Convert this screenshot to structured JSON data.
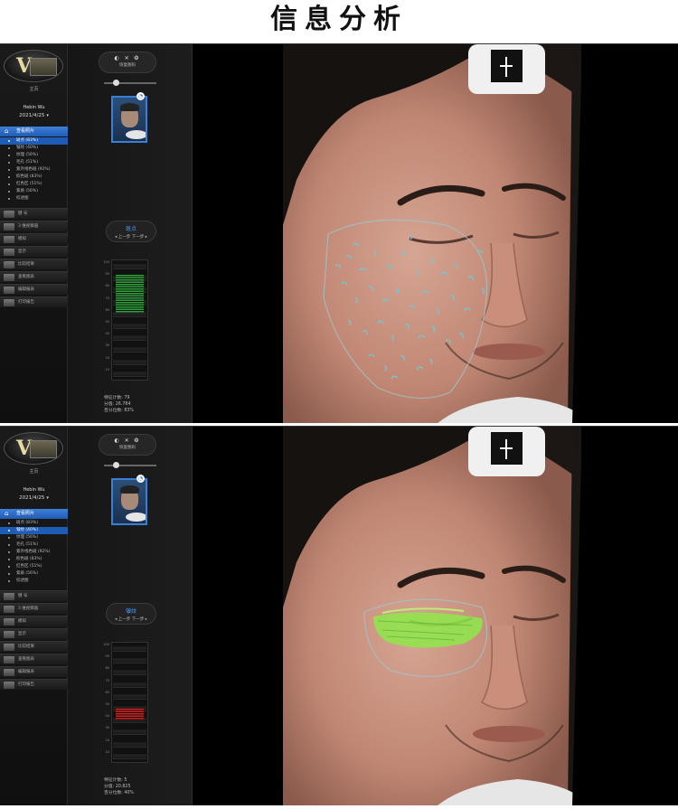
{
  "page": {
    "title": "信息分析"
  },
  "colors": {
    "accent_blue": "#2f6fd0",
    "pore_overlay": "#6fc9d8",
    "wrinkle_overlay": "#8fe84a",
    "gauge_green": "#2fa33a",
    "gauge_red": "#d42020"
  },
  "screens": [
    {
      "sidebar": {
        "home_label": "主页",
        "user_name": "Hebin Wu",
        "date": "2021/4/25",
        "menu_header": "查看照片",
        "analysis_items": [
          {
            "label": "斑点 (83%)",
            "active": true
          },
          {
            "label": "皱纹 (40%)",
            "active": false
          },
          {
            "label": "纹理 (56%)",
            "active": false
          },
          {
            "label": "毛孔 (51%)",
            "active": false
          },
          {
            "label": "紫外线色斑 (92%)",
            "active": false
          },
          {
            "label": "棕色斑 (83%)",
            "active": false
          },
          {
            "label": "红色区 (51%)",
            "active": false
          },
          {
            "label": "紫质 (56%)",
            "active": false
          },
          {
            "label": "综述图",
            "active": false
          }
        ],
        "sections": [
          "健 号",
          "3 维视察器",
          "模拟",
          "显示",
          "比较结果",
          "查看图表",
          "编辑报表",
          "打印报告"
        ]
      },
      "panel": {
        "reset_label": "恢复图码",
        "reset_icons": "◐ ✕ ❂",
        "feature_name": "斑点",
        "nav_label": "◂ 上一步  下一步 ▸",
        "gauge": {
          "value_percent": 83,
          "fill_color": "#2fa33a"
        },
        "scale_labels": [
          "100",
          "90",
          "80",
          "70",
          "60",
          "50",
          "40",
          "30",
          "20",
          "10"
        ],
        "stats": {
          "feature_count": "特征计数: 79",
          "score": "分值: 26.784",
          "percentile": "百分位数: 83%"
        }
      },
      "photo": {
        "overlay": "spots"
      }
    },
    {
      "sidebar": {
        "home_label": "主页",
        "user_name": "Hebin Wu",
        "date": "2021/4/25",
        "menu_header": "查看照片",
        "analysis_items": [
          {
            "label": "斑点 (83%)",
            "active": false
          },
          {
            "label": "皱纹 (40%)",
            "active": true
          },
          {
            "label": "纹理 (56%)",
            "active": false
          },
          {
            "label": "毛孔 (51%)",
            "active": false
          },
          {
            "label": "紫外线色斑 (92%)",
            "active": false
          },
          {
            "label": "棕色斑 (83%)",
            "active": false
          },
          {
            "label": "红色区 (51%)",
            "active": false
          },
          {
            "label": "紫质 (56%)",
            "active": false
          },
          {
            "label": "综述图",
            "active": false
          }
        ],
        "sections": [
          "健 号",
          "3 维视察器",
          "模拟",
          "显示",
          "比较结果",
          "查看图表",
          "编辑报表",
          "打印报告"
        ]
      },
      "panel": {
        "reset_label": "恢复图码",
        "reset_icons": "◐ ✕ ❂",
        "feature_name": "皱纹",
        "nav_label": "◂ 上一步  下一步 ▸",
        "gauge": {
          "value_percent": 40,
          "fill_color": "#d42020"
        },
        "scale_labels": [
          "100",
          "90",
          "80",
          "70",
          "60",
          "50",
          "40",
          "30",
          "20",
          "10"
        ],
        "stats": {
          "feature_count": "特征计数: 5",
          "score": "分值: 20.825",
          "percentile": "百分位数: 40%"
        }
      },
      "photo": {
        "overlay": "wrinkles"
      }
    }
  ]
}
